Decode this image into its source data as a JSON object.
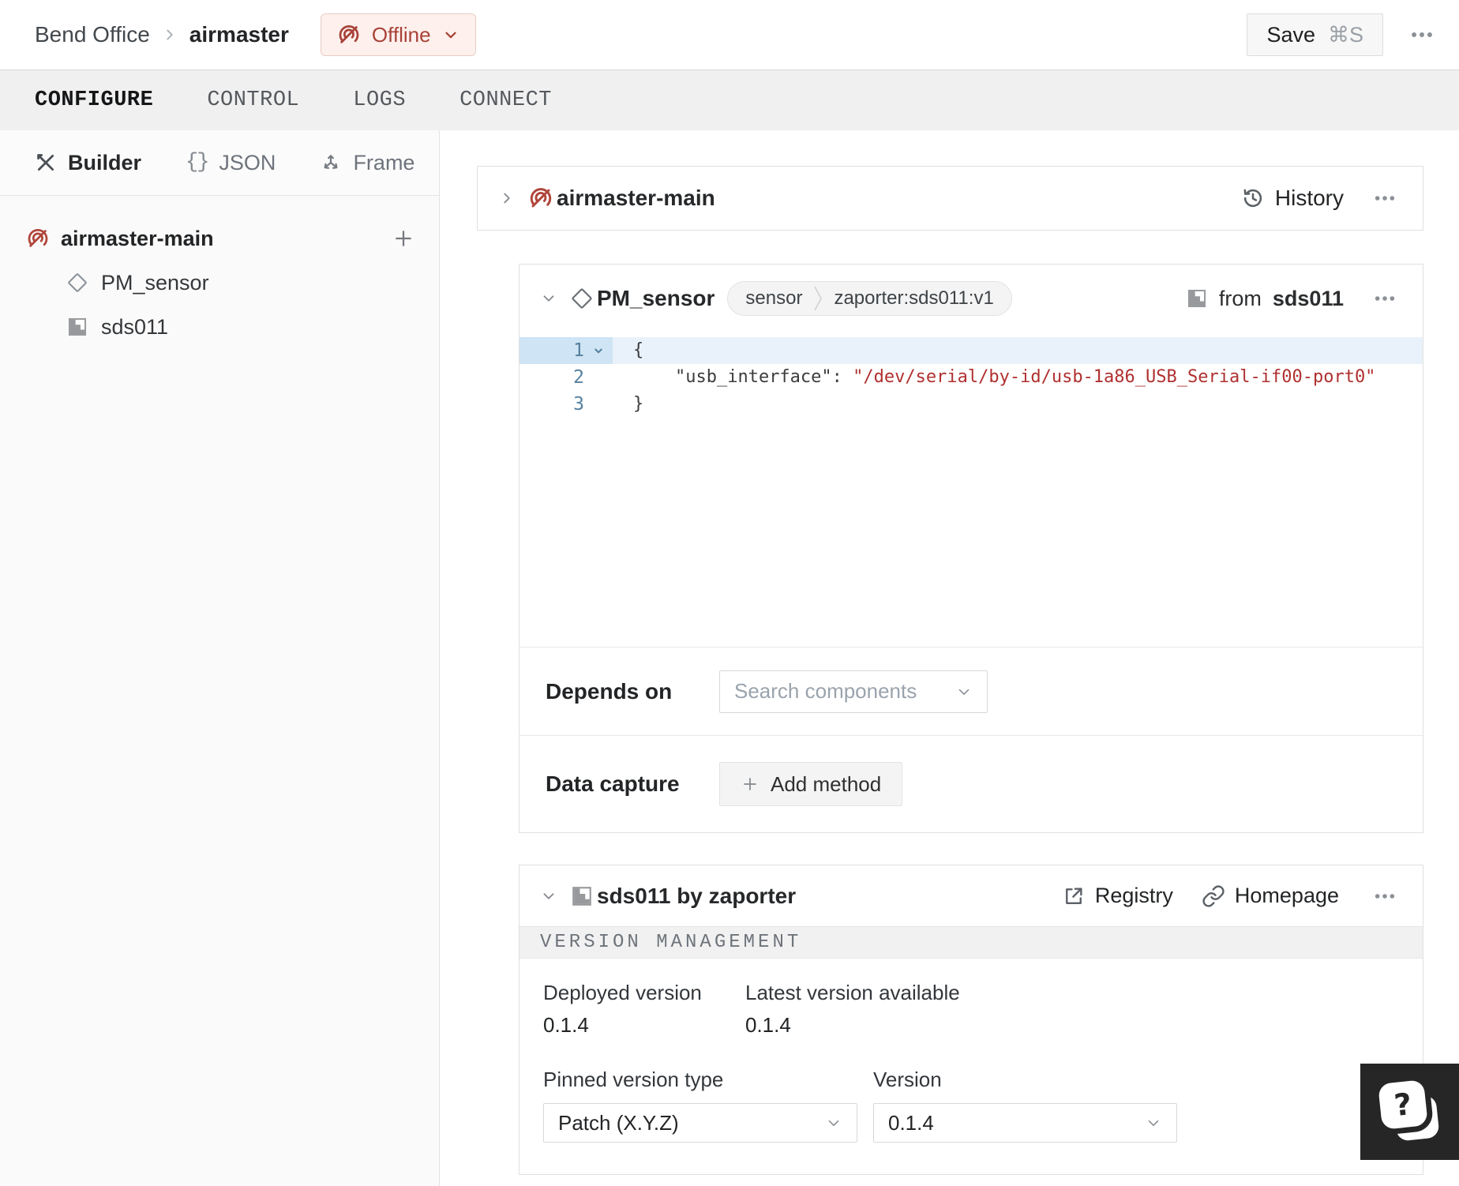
{
  "colors": {
    "offline_red": "#a84238",
    "offline_badge_bg": "#fdf0ed",
    "code_string_red": "#b03030",
    "code_line_number_blue": "#55809e",
    "active_line_bg": "#e9f2fb",
    "active_gutter_bg": "#cfe4f4",
    "tab_bar_bg": "#f0f0f1",
    "card_border": "#e0e0e0",
    "help_fab_bg": "#262626"
  },
  "header": {
    "breadcrumb": {
      "org": "Bend Office",
      "machine": "airmaster"
    },
    "status": {
      "label": "Offline"
    },
    "save": {
      "label": "Save",
      "shortcut": "⌘S"
    }
  },
  "tabs": [
    {
      "label": "CONFIGURE",
      "active": true
    },
    {
      "label": "CONTROL",
      "active": false
    },
    {
      "label": "LOGS",
      "active": false
    },
    {
      "label": "CONNECT",
      "active": false
    }
  ],
  "sidebar": {
    "modes": [
      {
        "label": "Builder",
        "active": true
      },
      {
        "label": "JSON",
        "active": false
      },
      {
        "label": "Frame",
        "active": false
      }
    ],
    "json_icon_glyph": "{}",
    "tree": {
      "root": "airmaster-main",
      "children": [
        {
          "label": "PM_sensor"
        },
        {
          "label": "sds011"
        }
      ]
    }
  },
  "main": {
    "machine_card": {
      "title": "airmaster-main",
      "history_label": "History"
    },
    "component_card": {
      "title": "PM_sensor",
      "tags": [
        "sensor",
        "zaporter:sds011:v1"
      ],
      "from_prefix": "from",
      "from_module": "sds011",
      "code": {
        "lines": [
          {
            "num": "1",
            "text": "{"
          },
          {
            "num": "2",
            "indent": "    ",
            "key": "\"usb_interface\"",
            "sep": ": ",
            "value": "\"/dev/serial/by-id/usb-1a86_USB_Serial-if00-port0\""
          },
          {
            "num": "3",
            "text": "}"
          }
        ]
      },
      "depends_on": {
        "label": "Depends on",
        "placeholder": "Search components"
      },
      "data_capture": {
        "label": "Data capture",
        "button_label": "Add method"
      }
    },
    "module_card": {
      "title": "sds011 by zaporter",
      "registry_label": "Registry",
      "homepage_label": "Homepage",
      "section_title": "VERSION MANAGEMENT",
      "deployed": {
        "label": "Deployed version",
        "value": "0.1.4"
      },
      "latest": {
        "label": "Latest version available",
        "value": "0.1.4"
      },
      "pinned_type": {
        "label": "Pinned version type",
        "value": "Patch (X.Y.Z)"
      },
      "version": {
        "label": "Version",
        "value": "0.1.4"
      }
    }
  },
  "help": {
    "glyph": "?"
  }
}
